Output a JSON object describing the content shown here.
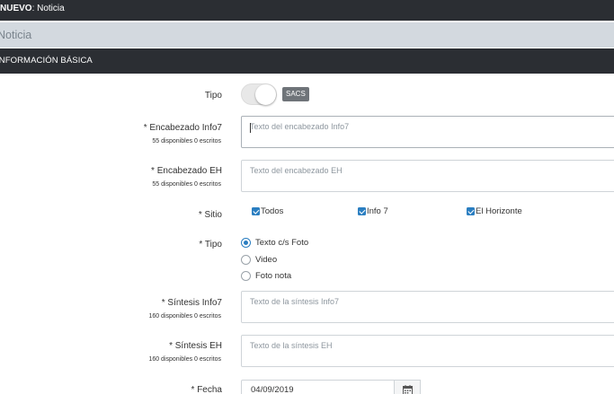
{
  "topbar": {
    "prefix": "NUEVO",
    "rest": ": Noticia"
  },
  "subbar": {
    "title": "Noticia"
  },
  "section": {
    "title": "INFORMACIÓN BÁSICA"
  },
  "tipo": {
    "label": "Tipo",
    "badge": "SACS"
  },
  "encabezado_info7": {
    "label": "* Encabezado Info7",
    "hint": "55 disponibles 0 escritos",
    "placeholder": "Texto del encabezado Info7"
  },
  "encabezado_eh": {
    "label": "* Encabezado EH",
    "hint": "55 disponibles 0 escritos",
    "placeholder": "Texto del encabezado EH"
  },
  "sitio": {
    "label": "* Sitio",
    "options": [
      "Todos",
      "Info 7",
      "El Horizonte"
    ]
  },
  "tipo_contenido": {
    "label": "* Tipo",
    "options": [
      "Texto c/s Foto",
      "Video",
      "Foto nota"
    ],
    "selected": "Texto c/s Foto"
  },
  "sintesis_info7": {
    "label": "* Síntesis Info7",
    "hint": "160 disponibles 0 escritos",
    "placeholder": "Texto de la síntesis Info7"
  },
  "sintesis_eh": {
    "label": "* Síntesis EH",
    "hint": "160 disponibles 0 escritos",
    "placeholder": "Texto de la síntesis EH"
  },
  "fecha": {
    "label": "* Fecha",
    "value": "04/09/2019"
  },
  "colors": {
    "dark_bar": "#2b2e33",
    "sub_bar": "#d3d9df",
    "accent": "#2a7ec1",
    "badge": "#6f7479"
  }
}
